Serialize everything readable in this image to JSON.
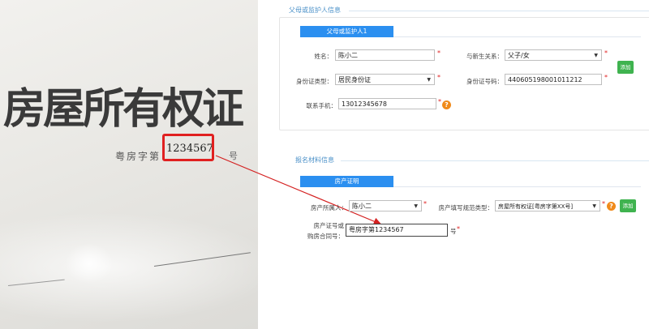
{
  "certificate": {
    "title": "房屋所有权证",
    "prefix": "粤房字第",
    "number": "1234567",
    "suffix": "号"
  },
  "guardian_section": {
    "title": "父母或监护人信息",
    "tab": "父母或监护人1",
    "name_label": "姓名：",
    "name_value": "陈小二",
    "relation_label": "与新生关系：",
    "relation_value": "父子/女",
    "id_type_label": "身份证类型：",
    "id_type_value": "居民身份证",
    "id_number_label": "身份证号码：",
    "id_number_value": "440605198001011212",
    "phone_label": "联系手机：",
    "phone_value": "13012345678",
    "add_label": "添加"
  },
  "material_section": {
    "title": "报名材料信息",
    "tab": "房产证明",
    "owner_label": "房产所属人：",
    "owner_value": "陈小二",
    "type_label": "房产填写规范类型：",
    "type_value": "房屋所有权证[粤房字第XX号]",
    "number_label_1": "房产证号或",
    "number_label_2": "购房合同号：",
    "number_value": "粤房字第1234567",
    "number_suffix": "号",
    "add_label": "添加"
  },
  "colors": {
    "accent": "#2b8ff0",
    "required": "#e02020",
    "help": "#f08a1a",
    "add_button": "#3fb34f",
    "highlight_box": "#e02020"
  },
  "icons": {
    "help": "question-circle-icon",
    "arrow": "red-arrow-icon"
  }
}
